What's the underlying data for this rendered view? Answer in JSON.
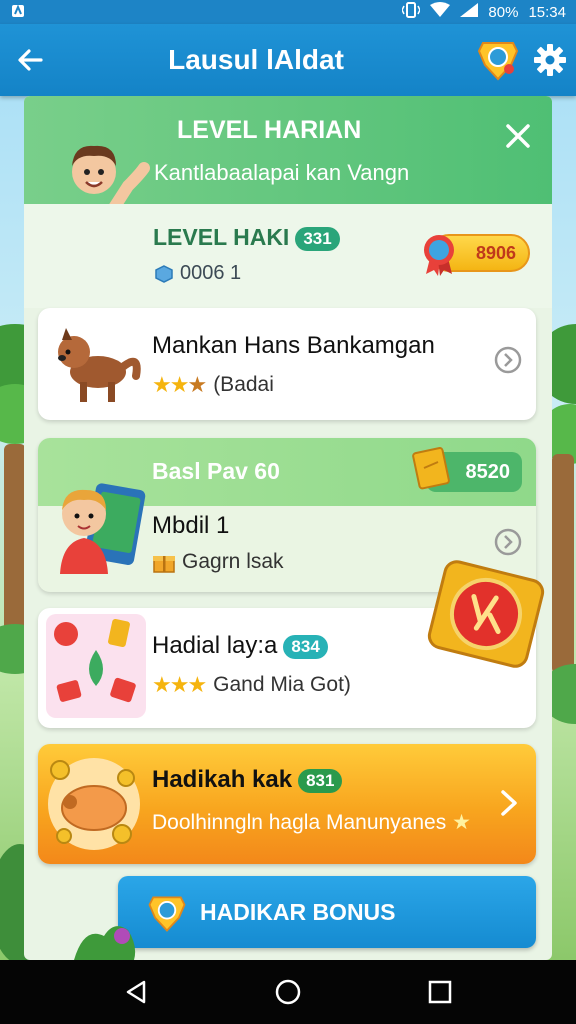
{
  "status_bar": {
    "left_icon": "notification-icon",
    "battery_text": "80%",
    "time": "15:34"
  },
  "app_bar": {
    "title": "Lausul lAldat",
    "back_icon": "arrow-left-icon",
    "trophy_icon": "trophy-badge-icon",
    "settings_icon": "gear-icon"
  },
  "header": {
    "title": "LEVEL HARIAN",
    "subtitle": "Kantlabaalapai kan Vangn"
  },
  "hero": {
    "title": "LEVEL HAKI",
    "badge": "331",
    "count": "0006 1",
    "coin_value": "8906"
  },
  "cards": [
    {
      "title": "Mankan Hans Bankamgan",
      "stars_filled": 3,
      "stars_total": 3,
      "subtitle": "(Badai"
    },
    {
      "banner_title": "Basl Pav 60",
      "badge_value": "8520",
      "title": "Mbdil 1",
      "subtitle": "Gagrn lsak"
    },
    {
      "title": "Hadial lay:a",
      "badge": "834",
      "stars_filled": 3,
      "stars_total": 3,
      "subtitle": "Gand Mia Got)"
    }
  ],
  "promo": {
    "title": "Hadikah kak",
    "badge": "831",
    "subtitle": "Doolhinngln hagla Manunyanes"
  },
  "bonus_button": {
    "label": "HADIKAR BONUS"
  },
  "colors": {
    "app_bar": "#1483c7",
    "header_green": "#4fbf74",
    "coin_gold": "#f4b514",
    "promo_orange": "#f8a51e",
    "bonus_blue": "#158bd1"
  }
}
